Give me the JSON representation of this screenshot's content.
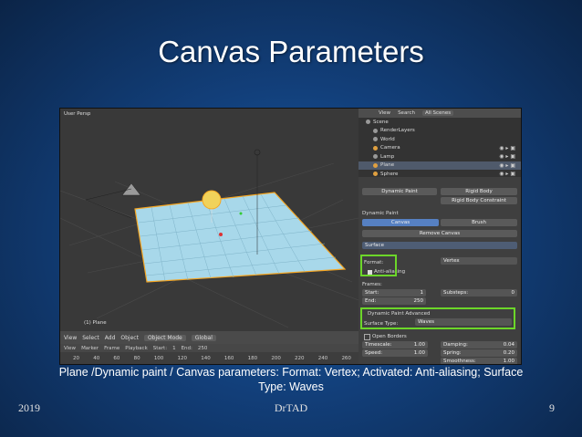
{
  "slide": {
    "title": "Canvas Parameters",
    "caption_line1": "Plane /Dynamic paint / Canvas parameters: Format: Vertex; Activated: Anti-aliasing; Surface",
    "caption_line2": "Type: Waves",
    "footer_left": "2019",
    "footer_center": "DrTAD",
    "footer_right": "9"
  },
  "screenshot": {
    "viewport": {
      "corner_label": "User Persp",
      "object_label": "(1) Plane"
    },
    "header_buttons": [
      "View",
      "Select",
      "Add",
      "Object",
      "Object Mode",
      "Global"
    ],
    "timeline": {
      "buttons": [
        "View",
        "Marker",
        "Frame",
        "Playback",
        "Start:",
        "1",
        "End:",
        "250"
      ],
      "ticks": [
        "20",
        "40",
        "60",
        "80",
        "100",
        "120",
        "140",
        "160",
        "180",
        "200",
        "220",
        "240",
        "260"
      ]
    },
    "outliner": {
      "header": [
        "View",
        "Search",
        "All Scenes"
      ],
      "items": [
        "Scene",
        "RenderLayers",
        "World",
        "Camera",
        "Lamp",
        "Plane",
        "Sphere"
      ]
    },
    "properties": {
      "tabs": [
        "Dynamic Paint",
        "Rigid Body",
        "Rigid Body Constraint"
      ],
      "panel_title": "Dynamic Paint",
      "mode_tabs": [
        "Canvas",
        "Brush"
      ],
      "remove_canvas": "Remove Canvas",
      "surface_item": "Surface",
      "format_label": "Format:",
      "format_value": "Vertex",
      "antialias_label": "Anti-aliasing",
      "frames_label": "Frames:",
      "start_label": "Start:",
      "start_value": "1",
      "end_label": "End:",
      "end_value": "250",
      "substeps_label": "Substeps:",
      "substeps_value": "0",
      "advanced_panel": "Dynamic Paint Advanced",
      "surface_type_label": "Surface Type:",
      "surface_type_value": "Waves",
      "open_borders": "Open Borders",
      "timescale_label": "Timescale:",
      "timescale_value": "1.00",
      "speed_label": "Speed:",
      "speed_value": "1.00",
      "damping_label": "Damping:",
      "damping_value": "0.04",
      "spring_label": "Spring:",
      "spring_value": "0.20",
      "smoothness_label": "Smoothness:",
      "smoothness_value": "1.00"
    }
  },
  "colors": {
    "highlight": "#6cd629",
    "plane": "#a8d8ea",
    "slide_bg": "#123f7a"
  }
}
